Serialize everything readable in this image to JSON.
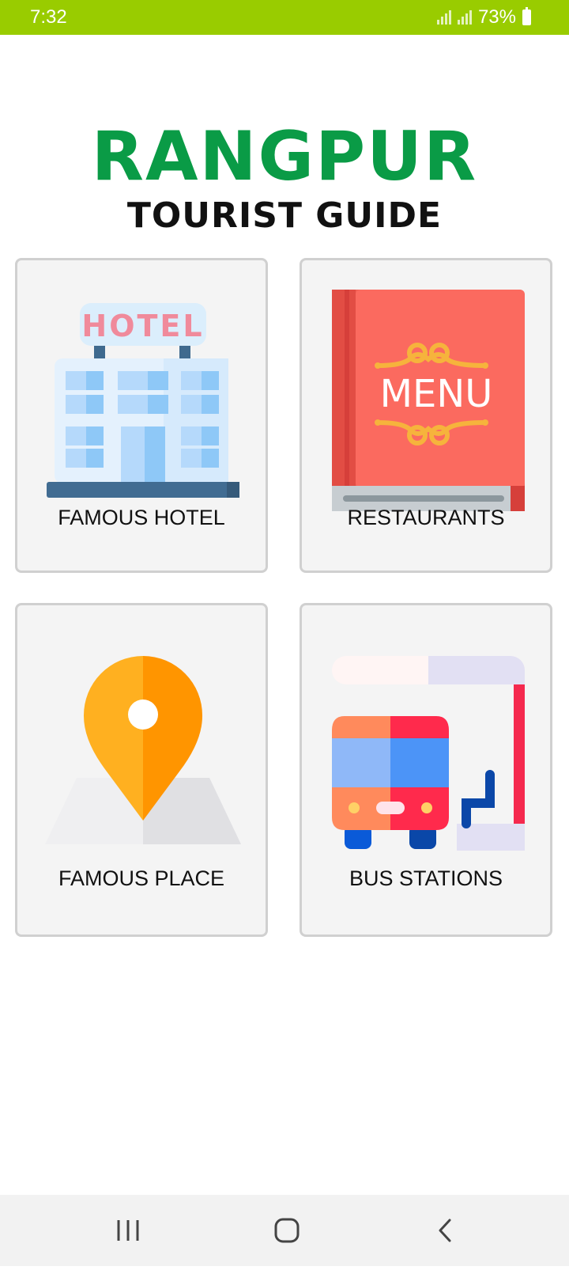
{
  "status": {
    "time": "7:32",
    "battery": "73%"
  },
  "header": {
    "title": "RANGPUR",
    "subtitle": "TOURIST GUIDE"
  },
  "cards": [
    {
      "label": "FAMOUS HOTEL",
      "icon": "hotel-icon"
    },
    {
      "label": "RESTAURANTS",
      "icon": "menu-book-icon"
    },
    {
      "label": "FAMOUS PLACE",
      "icon": "map-pin-icon"
    },
    {
      "label": "BUS STATIONS",
      "icon": "bus-stop-icon"
    }
  ],
  "icons": {
    "hotel_sign": "HOTEL",
    "menu_text": "MENU"
  },
  "colors": {
    "status_bar": "#99cc00",
    "title": "#0a9b46"
  },
  "nav": [
    "recent-apps-icon",
    "home-icon",
    "back-icon"
  ]
}
